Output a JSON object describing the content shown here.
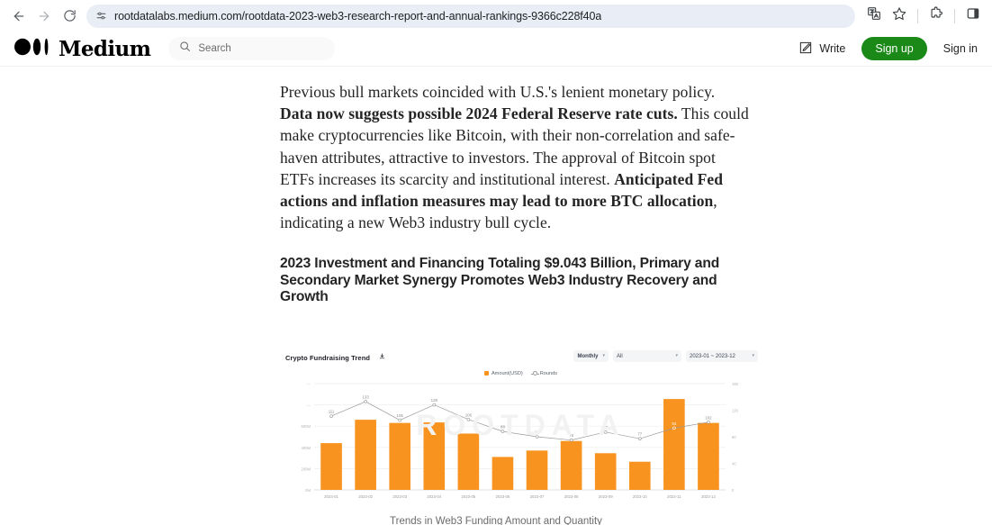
{
  "browser": {
    "back_icon": "back-arrow-icon",
    "forward_icon": "forward-arrow-icon",
    "reload_icon": "reload-icon",
    "url": "rootdatalabs.medium.com/rootdata-2023-web3-research-report-and-annual-rankings-9366c228f40a",
    "site_icon": "site-settings-icon",
    "translate_icon": "translate-icon",
    "bookmark_icon": "star-icon",
    "extensions_icon": "puzzle-piece-icon",
    "sidepanel_icon": "side-panel-icon"
  },
  "site_header": {
    "logo_text": "Medium",
    "search_placeholder": "Search",
    "write_label": "Write",
    "signup_label": "Sign up",
    "signin_label": "Sign in",
    "accent_green": "#1a8917"
  },
  "article": {
    "paragraph": {
      "part1": "Previous bull markets coincided with U.S.'s lenient monetary policy. ",
      "bold1": "Data now suggests possible 2024 Federal Reserve rate cuts.",
      "part2": " This could make cryptocurrencies like Bitcoin, with their non-correlation and safe-haven attributes, attractive to investors. The approval of Bitcoin spot ETFs increases its scarcity and institutional interest. ",
      "bold2": "Anticipated Fed actions and inflation measures may lead to more BTC allocation",
      "part3": ", indicating a new Web3 industry bull cycle."
    },
    "section_heading": "2023 Investment and Financing Totaling $9.043 Billion, Primary and Secondary Market Synergy Promotes Web3 Industry Recovery and Growth",
    "figure_caption": "Trends in Web3 Funding Amount and Quantity"
  },
  "chart_widget": {
    "title": "Crypto Fundraising Trend",
    "download_icon": "download-icon",
    "controls": [
      {
        "name": "period-select",
        "value": "Monthly"
      },
      {
        "name": "category-select",
        "value": "All"
      },
      {
        "name": "date-range-select",
        "value": "2023-01  ~  2023-12"
      }
    ],
    "watermark": "ROOTDATA"
  },
  "chart_data": {
    "type": "bar",
    "title": "Crypto Fundraising Trend",
    "xlabel": "",
    "ylabel": "Amount(USD)",
    "y2label": "Rounds",
    "categories": [
      "2023-01",
      "2023-02",
      "2023-03",
      "2023-04",
      "2023-05",
      "2023-06",
      "2023-07",
      "2023-08",
      "2023-09",
      "2023-10",
      "2023-11",
      "2023-12"
    ],
    "legend": [
      "Amount(USD)",
      "Rounds"
    ],
    "legend_position": "top-center",
    "grid": true,
    "ylim": [
      0,
      1000
    ],
    "ytick_labels": [
      "0M",
      "200M",
      "400M",
      "600M",
      "",
      ""
    ],
    "ytick_values": [
      0,
      200,
      400,
      600,
      800,
      1000
    ],
    "y2lim": [
      0,
      160
    ],
    "y2tick_labels": [
      "0",
      "40",
      "80",
      "120",
      "160"
    ],
    "y2tick_values": [
      0,
      40,
      80,
      120,
      160
    ],
    "series": [
      {
        "name": "Amount(USD)",
        "type": "bar",
        "color": "#F7931E",
        "unit": "M USD",
        "values": [
          440,
          660,
          630,
          635,
          530,
          310,
          370,
          460,
          345,
          265,
          855,
          630
        ]
      },
      {
        "name": "Rounds",
        "type": "line",
        "color": "#9a9a9a",
        "values": [
          111,
          133,
          105,
          128,
          106,
          88,
          80,
          75,
          87,
          77,
          93,
          102
        ],
        "labels": [
          "111",
          "133",
          "105",
          "128",
          "106",
          "88",
          "80",
          "75",
          "87",
          "77",
          "93",
          "102"
        ]
      }
    ]
  }
}
